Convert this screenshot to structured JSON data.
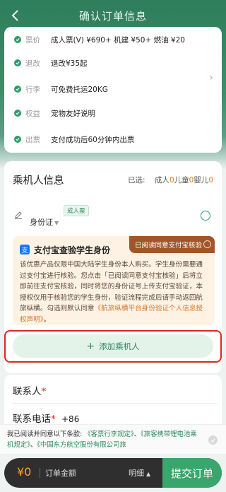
{
  "header": {
    "title": "确认订单信息"
  },
  "info": {
    "rows": [
      {
        "key": "票价",
        "value": "成人票(V) ¥690+ 机建 ¥50+ 燃油 ¥20"
      },
      {
        "key": "退改",
        "value": "退改¥35起"
      },
      {
        "key": "行李",
        "value": "可免费托运20KG"
      },
      {
        "key": "权益",
        "value": "宠物友好说明"
      },
      {
        "key": "出票",
        "value": "支付成功后60分钟内出票"
      }
    ]
  },
  "passenger": {
    "title": "乘机人信息",
    "selected_label": "已选:",
    "adult_label": "成人",
    "adult_count": "0",
    "child_label": "儿童",
    "child_count": "0",
    "infant_label": "婴儿",
    "infant_count": "0",
    "adult_badge": "成人票",
    "id_type": "身份证",
    "alipay": {
      "logo": "支",
      "title": "支付宝查验学生身份",
      "consent": "已阅读同意支付宝核验",
      "desc": "该优惠产品仅限中国大陆学生身份本人购买。学生身份需要通过支付宝进行核验。您点击「已阅读同意支付宝核验」后将立即前往支付宝核验，同时将您的身份证号上传支付宝验证，本授权仅用于核验您的学生身份，验证流程完成后请手动返回航旅纵横。勾选则默认同意",
      "link": "《航旅纵横平台身份验证个人信息授权声明》",
      "end": "。"
    },
    "add_label": "添加乘机人"
  },
  "contact": {
    "name_label": "联系人",
    "phone_label": "联系电话",
    "required_mark": "*",
    "area_code": "+86"
  },
  "terms": {
    "prefix": "我已阅读并同意以下条款:",
    "link1": "《客票行李规定》",
    "sep1": "、",
    "link2": "《旅客携带锂电池乘机规定》",
    "sep2": "、",
    "link3": "《中国东方航空股份有限公司旅"
  },
  "bottom": {
    "price": "¥0",
    "price_label": "订单金额",
    "detail_label": "明细",
    "submit_label": "提交订单"
  },
  "colors": {
    "brand": "#2f9a6a",
    "accent": "#f5a623",
    "highlight": "#e0271b"
  }
}
